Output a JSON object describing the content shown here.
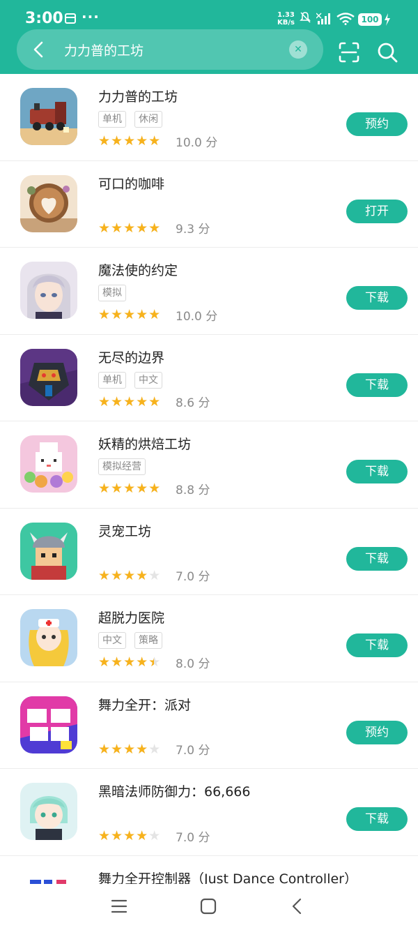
{
  "status_bar": {
    "time": "3:00",
    "more": "···",
    "net_speed_value": "1.33",
    "net_speed_unit": "KB/s",
    "battery": "100"
  },
  "search": {
    "query": "力力普的工坊"
  },
  "colors": {
    "brand": "#21b79b",
    "star": "#f7b21c",
    "star_empty": "#e4e4e4"
  },
  "results": [
    {
      "name": "力力普的工坊",
      "tags": [
        "单机",
        "休闲"
      ],
      "stars": 5,
      "score": "10.0 分",
      "action": "预约",
      "icon": "railway-train-game-icon"
    },
    {
      "name": "可口的咖啡",
      "tags": [],
      "stars": 4.5,
      "score": "9.3 分",
      "action": "打开",
      "icon": "latte-art-coffee-game-icon"
    },
    {
      "name": "魔法使的约定",
      "tags": [
        "模拟"
      ],
      "stars": 5,
      "score": "10.0 分",
      "action": "下载",
      "icon": "anime-character-game-icon"
    },
    {
      "name": "无尽的边界",
      "tags": [
        "单机",
        "中文"
      ],
      "stars": 4.5,
      "score": "8.6 分",
      "action": "下载",
      "icon": "armored-robot-game-icon"
    },
    {
      "name": "妖精的烘焙工坊",
      "tags": [
        "模拟经营"
      ],
      "stars": 4.5,
      "score": "8.8 分",
      "action": "下载",
      "icon": "pixel-baker-cat-game-icon"
    },
    {
      "name": "灵宠工坊",
      "tags": [],
      "stars": 3.5,
      "score": "7.0 分",
      "action": "下载",
      "icon": "horned-helmet-warrior-game-icon"
    },
    {
      "name": "超脱力医院",
      "tags": [
        "中文",
        "策略"
      ],
      "stars": 4,
      "score": "8.0 分",
      "action": "下载",
      "icon": "nurse-character-game-icon"
    },
    {
      "name": "舞力全开：派对",
      "tags": [],
      "stars": 3.5,
      "score": "7.0 分",
      "action": "预约",
      "icon": "just-dance-logo-icon"
    },
    {
      "name": "黑暗法师防御力：66,666",
      "tags": [],
      "stars": 3.5,
      "score": "7.0 分",
      "action": "下载",
      "icon": "chibi-mage-game-icon"
    },
    {
      "name": "舞力全开控制器（Just Dance Controller）",
      "tags": [],
      "stars": 0,
      "score": "",
      "action": "",
      "icon": "just-dance-controller-app-icon"
    }
  ]
}
